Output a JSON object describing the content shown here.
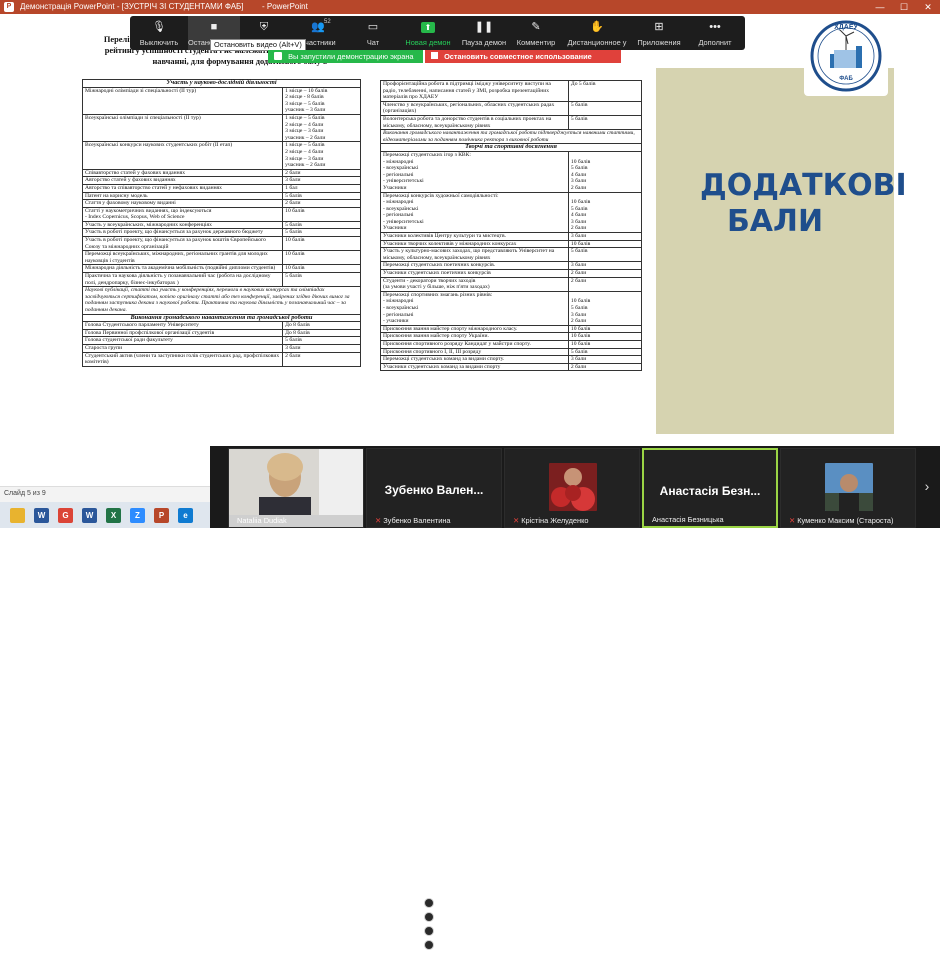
{
  "titlebar": {
    "app_short": "P",
    "title": "Демонстрація PowerPoint - [ЗУСТРІЧ ЗІ СТУДЕНТАМИ ФАБ]",
    "title_suffix": "- PowerPoint",
    "minimize": "—",
    "maximize": "☐",
    "close": "✕"
  },
  "zoom_toolbar": {
    "items": [
      {
        "label": "Выключить",
        "icon": "microphone-icon"
      },
      {
        "label": "Остановить видео",
        "icon": "video-camera-icon"
      },
      {
        "label": "Безопасность",
        "icon": "shield-icon"
      },
      {
        "label": "Участники",
        "icon": "participants-icon",
        "badge": "52"
      },
      {
        "label": "Чат",
        "icon": "chat-icon"
      },
      {
        "label": "Новая демон",
        "icon": "share-screen-icon"
      },
      {
        "label": "Пауза демон",
        "icon": "pause-icon"
      },
      {
        "label": "Комментир",
        "icon": "annotate-icon"
      },
      {
        "label": "Дистанционное у",
        "icon": "remote-control-icon"
      },
      {
        "label": "Приложения",
        "icon": "apps-icon"
      },
      {
        "label": "Дополнит",
        "icon": "more-icon"
      }
    ],
    "tooltip": "Остановить видео (Alt+V)",
    "share_banner": "Вы запустили демонстрацию экрана",
    "stop_share": "Остановить совместное использование"
  },
  "slide": {
    "heading": "ДОДАТКОВІ БАЛИ",
    "logo_text": "ХДАЕУ",
    "logo_sub": "ФАБ",
    "doc_title": "Перелік досягнень на поточний семестр, що не входять до підсумкового рейтингу успішності студента і не належать до показників успішності у навчанні, для формування додаткового балу b",
    "left_table": [
      {
        "type": "section",
        "text": "Участь у науково-дослідній діяльності"
      },
      {
        "c1": "Міжнародні олімпіади зі спеціальності (ІІ тур)",
        "c2": "1 місце – 10 балів\n2 місце - 8 балів\n3 місце – 5 балів\nучасник – 3 бали"
      },
      {
        "c1": "Всеукраїнські олімпіади зі спеціальності (ІІ тур)",
        "c2": "1 місце – 5 балів\n2 місце – 4 бали\n3 місце – 3 бали\nучасник – 2 бали"
      },
      {
        "c1": "Всеукраїнські конкурси наукових студентських робіт (ІІ етап)",
        "c2": "1 місце – 5 балів\n2 місце – 4 бали\n3 місце – 3 бали\nучасник – 2 бали"
      },
      {
        "c1": "Співавторство статей у фахових виданнях",
        "c2": "2 бали"
      },
      {
        "c1": "Авторство статей у фахових виданнях",
        "c2": "3 бали"
      },
      {
        "c1": "Авторство та співавторство статей у нефахових виданнях",
        "c2": "1 бал"
      },
      {
        "c1": "Патент на корисну модель",
        "c2": "5 балів"
      },
      {
        "c1": "Стаття у фаховому науковому виданні",
        "c2": "2 бали"
      },
      {
        "c1": "Статті у наукометричних виданнях, що індексуються\n- Index Copernicus, Scopus, Web of Science",
        "c2": "10 балів"
      },
      {
        "c1": "Участь у всеукраїнських, міжнародних конференціях",
        "c2": "5 балів"
      },
      {
        "c1": "Участь в роботі проекту, що фінансується за рахунок державного бюджету",
        "c2": "5 балів"
      },
      {
        "c1": "Участь в роботі проекту, що фінансується за рахунок коштів Європейського Союзу та міжнародних організацій",
        "c2": "10 балів"
      },
      {
        "c1": "Переможці всеукраїнських, міжнародних, регіональних грантів для молодих науковців і студентів",
        "c2": "10 балів"
      },
      {
        "c1": "Міжнародна діяльність та академічна мобільність (подвійні дипломи студентів)",
        "c2": "10 балів"
      },
      {
        "c1": "Практична та наукова діяльність у позанавчальний час (робота на дослідному полі, дендропарку, бізнес-інкубаторах )",
        "c2": "5 балів"
      },
      {
        "type": "note",
        "text": "Наукові публікації, статті та участь у конференціях, перемоги в наукових конкурсах та олімпіадах засвідчуються сертифікатом, копією оригіналу статті або тез конференції, завірених згідно діючих вимог за поданням заступника декана з наукової роботи. Практична та наукова діяльність у позанавчальний час – за поданням декана."
      },
      {
        "type": "section",
        "text": "Виконання громадського навантаження та громадської роботи"
      },
      {
        "c1": "Голова Студентського парламенту Університету",
        "c2": "До 8 балів"
      },
      {
        "c1": "Голова Первинної профспілкової організації студентів",
        "c2": "До 8 балів"
      },
      {
        "c1": "Голова студентської ради факультету",
        "c2": "5 балів"
      },
      {
        "c1": "Староста групи",
        "c2": "3 бали"
      },
      {
        "c1": "Студентський актив (члени та заступники голів студентських рад, профспілкових комітетів)",
        "c2": "2 бали"
      }
    ],
    "right_table": [
      {
        "c1": "Профорієнтаційна робота в підтримці іміджу університету виступи на радіо, телебаченні, написання статей у ЗМІ, розробка презентаційних матеріалів про ХДАЕУ",
        "c2": "До 5 балів"
      },
      {
        "c1": "Членство у всеукраїнських, регіональних, обласних студентських радах (організаціях)",
        "c2": "5 балів"
      },
      {
        "c1": "Волонтерська робота та донорство студентів в соціальних проектах на міському, обласному, всеукраїнському рівнях",
        "c2": "5 балів"
      },
      {
        "type": "note",
        "text": "Виконання громадського навантаження та громадської роботи підтверджується наявними статтями, відеоматеріалами за поданням помічника ректора з виховної роботи"
      },
      {
        "type": "section",
        "text": "Творчі та спортивні досягнення"
      },
      {
        "c1": "Переможці студентських ігор з КВК:\n- міжнародні\n- всеукраїнські\n- регіональні\n- університетські\nУчасники",
        "c2": "\n10 балів\n5 балів\n4 бали\n3 бали\n2 бали"
      },
      {
        "c1": "Переможці конкурсів художньої самодіяльності:\n- міжнародні\n- всеукраїнські\n- регіональні\n- університетські\nУчасники",
        "c2": "\n10 балів\n5 балів\n4 бали\n3 бали\n2 бали"
      },
      {
        "c1": "Учасники колективів Центру культури та мистецтв.",
        "c2": "3 бали"
      },
      {
        "c1": "Учасники творчих колективів у міжнародних конкурсах",
        "c2": "10 балів"
      },
      {
        "c1": "Участь у культурно-масових заходах, що представляють Університет на міському, обласному, всеукраїнському рівнях",
        "c2": "5 балів"
      },
      {
        "c1": "Переможці студентських поетичних конкурсів.",
        "c2": "3 бали"
      },
      {
        "c1": "Учасники студентських поетичних конкурсів",
        "c2": "2 бали"
      },
      {
        "c1": "Студенти - декоратори творчих заходів\n(за умови участі у більше, ніж п'яти заходах)",
        "c2": "2 бали"
      },
      {
        "c1": "Переможці спортивних змагань різних рівнів:\n- міжнародні\n- всеукраїнські\n- регіональні\n- учасники",
        "c2": "\n10 балів\n5 балів\n3 бали\n2 бали"
      },
      {
        "c1": "Присвоєння звання майстер спорту міжнародного класу.",
        "c2": "10 балів"
      },
      {
        "c1": "Присвоєння звання майстер спорту України.",
        "c2": "10 балів"
      },
      {
        "c1": "Присвоєння спортивного розряду Кандидат у майстри спорту.",
        "c2": "10 балів"
      },
      {
        "c1": "Присвоєння спортивного І, ІІ, ІІІ розряду",
        "c2": "5 балів"
      },
      {
        "c1": "Переможці студентських команд за видами спорту.",
        "c2": "3 бали"
      },
      {
        "c1": "Учасники студентських команд за видами спорту",
        "c2": "2 бали"
      }
    ]
  },
  "statusbar": {
    "slide_info": "Слайд 5 из 9"
  },
  "taskbar": {
    "apps": [
      {
        "name": "file-explorer-icon",
        "letter": "",
        "color": "#e8b32f"
      },
      {
        "name": "word-icon",
        "letter": "W",
        "color": "#2b579a"
      },
      {
        "name": "chrome-icon",
        "letter": "G",
        "color": "#db4437"
      },
      {
        "name": "word-icon-2",
        "letter": "W",
        "color": "#2b579a"
      },
      {
        "name": "excel-icon",
        "letter": "X",
        "color": "#217346"
      },
      {
        "name": "zoom-icon",
        "letter": "Z",
        "color": "#2d8cff"
      },
      {
        "name": "powerpoint-icon",
        "letter": "P",
        "color": "#b7472a"
      },
      {
        "name": "edge-icon",
        "letter": "e",
        "color": "#0f7bd1"
      }
    ]
  },
  "participants": [
    {
      "name": "Nataliia Dudiak",
      "show_big": false
    },
    {
      "name": "Зубенко Валентина",
      "big": "Зубенко Вален...",
      "show_big": true
    },
    {
      "name": "Крістіна Желуденко",
      "show_big": false
    },
    {
      "name": "Анастасія Безницька",
      "big": "Анастасія Безн...",
      "show_big": true
    },
    {
      "name": "Куменко Максим (Староста)",
      "show_big": false
    }
  ],
  "strip_next": "›"
}
